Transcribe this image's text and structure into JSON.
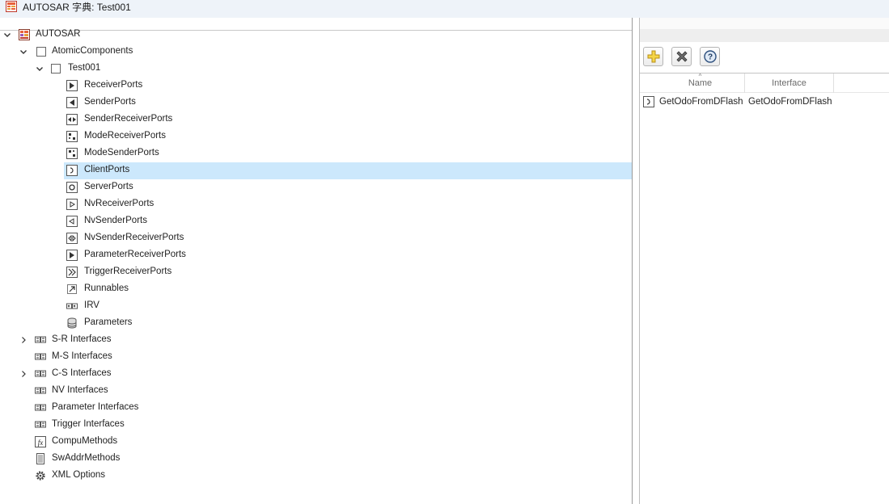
{
  "window": {
    "title": "AUTOSAR 字典: Test001"
  },
  "tree": {
    "root": "AUTOSAR",
    "atomic_components": "AtomicComponents",
    "component": "Test001",
    "port_items": [
      {
        "label": "ReceiverPorts",
        "icon": "receiver-port-icon"
      },
      {
        "label": "SenderPorts",
        "icon": "sender-port-icon"
      },
      {
        "label": "SenderReceiverPorts",
        "icon": "sender-receiver-port-icon"
      },
      {
        "label": "ModeReceiverPorts",
        "icon": "mode-receiver-port-icon"
      },
      {
        "label": "ModeSenderPorts",
        "icon": "mode-sender-port-icon"
      },
      {
        "label": "ClientPorts",
        "icon": "client-port-icon"
      },
      {
        "label": "ServerPorts",
        "icon": "server-port-icon"
      },
      {
        "label": "NvReceiverPorts",
        "icon": "nv-receiver-port-icon"
      },
      {
        "label": "NvSenderPorts",
        "icon": "nv-sender-port-icon"
      },
      {
        "label": "NvSenderReceiverPorts",
        "icon": "nv-sender-receiver-port-icon"
      },
      {
        "label": "ParameterReceiverPorts",
        "icon": "parameter-receiver-port-icon"
      },
      {
        "label": "TriggerReceiverPorts",
        "icon": "trigger-receiver-port-icon"
      },
      {
        "label": "Runnables",
        "icon": "runnable-icon"
      },
      {
        "label": "IRV",
        "icon": "irv-icon"
      },
      {
        "label": "Parameters",
        "icon": "parameters-icon"
      }
    ],
    "selected_item": "ClientPorts",
    "top_items": [
      {
        "label": "S-R Interfaces",
        "expandable": true,
        "icon": "interface-icon"
      },
      {
        "label": "M-S Interfaces",
        "expandable": false,
        "icon": "interface-icon"
      },
      {
        "label": "C-S Interfaces",
        "expandable": true,
        "icon": "interface-icon"
      },
      {
        "label": "NV Interfaces",
        "expandable": false,
        "icon": "interface-icon"
      },
      {
        "label": "Parameter Interfaces",
        "expandable": false,
        "icon": "interface-icon"
      },
      {
        "label": "Trigger Interfaces",
        "expandable": false,
        "icon": "interface-icon"
      },
      {
        "label": "CompuMethods",
        "expandable": false,
        "icon": "compu-method-icon"
      },
      {
        "label": "SwAddrMethods",
        "expandable": false,
        "icon": "sw-addr-method-icon"
      },
      {
        "label": "XML Options",
        "expandable": false,
        "icon": "gear-icon"
      }
    ]
  },
  "toolbar": {
    "add": "add-icon",
    "delete": "delete-icon",
    "help": "help-icon"
  },
  "table": {
    "columns": [
      "Name",
      "Interface"
    ],
    "rows": [
      {
        "name": "GetOdoFromDFlash",
        "interface": "GetOdoFromDFlash",
        "icon": "client-port-icon"
      }
    ]
  },
  "colors": {
    "selection": "#cce8fc",
    "titlebar": "#eef3f9"
  }
}
